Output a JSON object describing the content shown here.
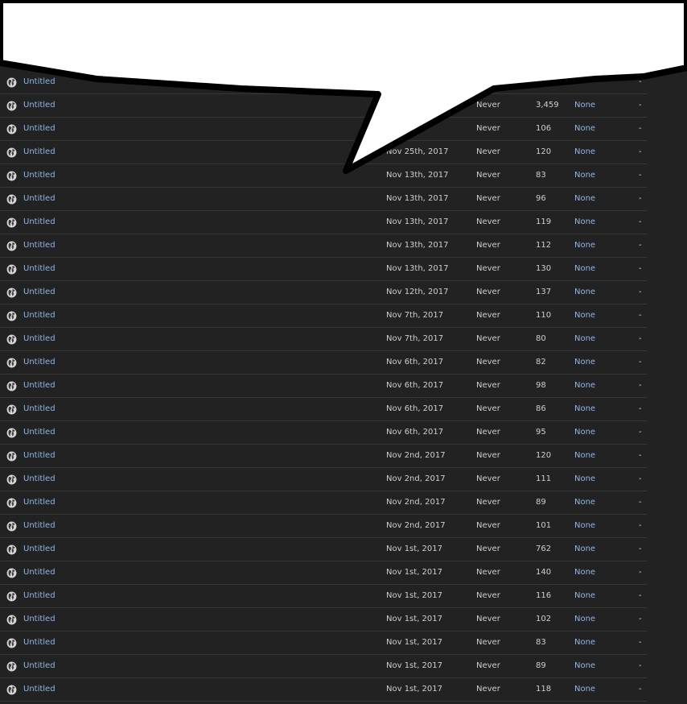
{
  "paste_list": {
    "rows": [
      {
        "title": "Untitled",
        "date": "",
        "expires": "",
        "hits": "",
        "syntax": "",
        "dash": "-"
      },
      {
        "title": "Untitled",
        "date": "",
        "expires": "Never",
        "hits": "3,459",
        "syntax": "None",
        "dash": "-"
      },
      {
        "title": "Untitled",
        "date": "",
        "expires": "Never",
        "hits": "106",
        "syntax": "None",
        "dash": "-"
      },
      {
        "title": "Untitled",
        "date": "Nov 25th, 2017",
        "expires": "Never",
        "hits": "120",
        "syntax": "None",
        "dash": "-"
      },
      {
        "title": "Untitled",
        "date": "Nov 13th, 2017",
        "expires": "Never",
        "hits": "83",
        "syntax": "None",
        "dash": "-"
      },
      {
        "title": "Untitled",
        "date": "Nov 13th, 2017",
        "expires": "Never",
        "hits": "96",
        "syntax": "None",
        "dash": "-"
      },
      {
        "title": "Untitled",
        "date": "Nov 13th, 2017",
        "expires": "Never",
        "hits": "119",
        "syntax": "None",
        "dash": "-"
      },
      {
        "title": "Untitled",
        "date": "Nov 13th, 2017",
        "expires": "Never",
        "hits": "112",
        "syntax": "None",
        "dash": "-"
      },
      {
        "title": "Untitled",
        "date": "Nov 13th, 2017",
        "expires": "Never",
        "hits": "130",
        "syntax": "None",
        "dash": "-"
      },
      {
        "title": "Untitled",
        "date": "Nov 12th, 2017",
        "expires": "Never",
        "hits": "137",
        "syntax": "None",
        "dash": "-"
      },
      {
        "title": "Untitled",
        "date": "Nov 7th, 2017",
        "expires": "Never",
        "hits": "110",
        "syntax": "None",
        "dash": "-"
      },
      {
        "title": "Untitled",
        "date": "Nov 7th, 2017",
        "expires": "Never",
        "hits": "80",
        "syntax": "None",
        "dash": "-"
      },
      {
        "title": "Untitled",
        "date": "Nov 6th, 2017",
        "expires": "Never",
        "hits": "82",
        "syntax": "None",
        "dash": "-"
      },
      {
        "title": "Untitled",
        "date": "Nov 6th, 2017",
        "expires": "Never",
        "hits": "98",
        "syntax": "None",
        "dash": "-"
      },
      {
        "title": "Untitled",
        "date": "Nov 6th, 2017",
        "expires": "Never",
        "hits": "86",
        "syntax": "None",
        "dash": "-"
      },
      {
        "title": "Untitled",
        "date": "Nov 6th, 2017",
        "expires": "Never",
        "hits": "95",
        "syntax": "None",
        "dash": "-"
      },
      {
        "title": "Untitled",
        "date": "Nov 2nd, 2017",
        "expires": "Never",
        "hits": "120",
        "syntax": "None",
        "dash": "-"
      },
      {
        "title": "Untitled",
        "date": "Nov 2nd, 2017",
        "expires": "Never",
        "hits": "111",
        "syntax": "None",
        "dash": "-"
      },
      {
        "title": "Untitled",
        "date": "Nov 2nd, 2017",
        "expires": "Never",
        "hits": "89",
        "syntax": "None",
        "dash": "-"
      },
      {
        "title": "Untitled",
        "date": "Nov 2nd, 2017",
        "expires": "Never",
        "hits": "101",
        "syntax": "None",
        "dash": "-"
      },
      {
        "title": "Untitled",
        "date": "Nov 1st, 2017",
        "expires": "Never",
        "hits": "762",
        "syntax": "None",
        "dash": "-"
      },
      {
        "title": "Untitled",
        "date": "Nov 1st, 2017",
        "expires": "Never",
        "hits": "140",
        "syntax": "None",
        "dash": "-"
      },
      {
        "title": "Untitled",
        "date": "Nov 1st, 2017",
        "expires": "Never",
        "hits": "116",
        "syntax": "None",
        "dash": "-"
      },
      {
        "title": "Untitled",
        "date": "Nov 1st, 2017",
        "expires": "Never",
        "hits": "102",
        "syntax": "None",
        "dash": "-"
      },
      {
        "title": "Untitled",
        "date": "Nov 1st, 2017",
        "expires": "Never",
        "hits": "83",
        "syntax": "None",
        "dash": "-"
      },
      {
        "title": "Untitled",
        "date": "Nov 1st, 2017",
        "expires": "Never",
        "hits": "89",
        "syntax": "None",
        "dash": "-"
      },
      {
        "title": "Untitled",
        "date": "Nov 1st, 2017",
        "expires": "Never",
        "hits": "118",
        "syntax": "None",
        "dash": "-"
      }
    ]
  },
  "icons": {
    "row_icon": "globe-icon"
  },
  "colors": {
    "background": "#222222",
    "link": "#8fb6e6",
    "text": "#cfcfcf",
    "row_divider": "#363636",
    "bubble_fill": "#ffffff",
    "bubble_outline": "#000000"
  }
}
